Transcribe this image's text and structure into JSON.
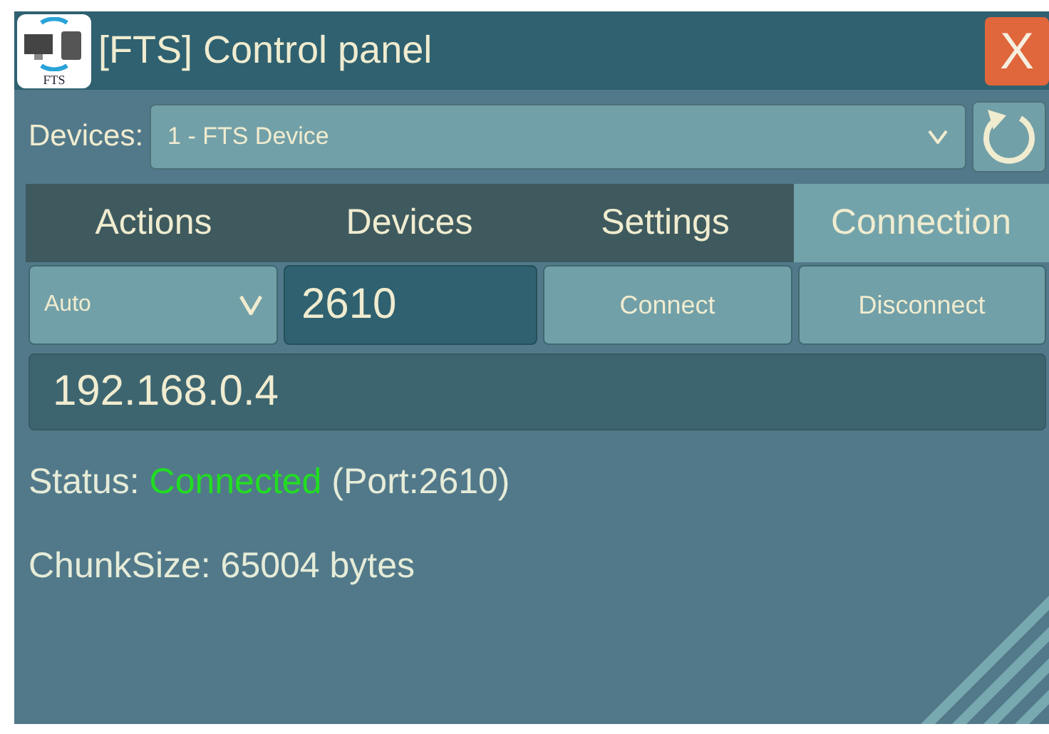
{
  "window": {
    "title": "[FTS] Control panel",
    "logo_text": "FTS",
    "close": "X"
  },
  "device_selector": {
    "label": "Devices:",
    "value": "1 - FTS Device"
  },
  "tabs": [
    {
      "label": "Actions",
      "selected": false
    },
    {
      "label": "Devices",
      "selected": false
    },
    {
      "label": "Settings",
      "selected": false
    },
    {
      "label": "Connection",
      "selected": true
    }
  ],
  "connection": {
    "mode": "Auto",
    "port": "2610",
    "buttons": [
      "Connect",
      "Disconnect"
    ],
    "address": "192.168.0.4"
  },
  "status": {
    "label": "Status:",
    "value": "Connected",
    "color": "#22dd22",
    "detail": "(Port:2610)"
  },
  "chunk_size": "ChunkSize: 65004 bytes"
}
